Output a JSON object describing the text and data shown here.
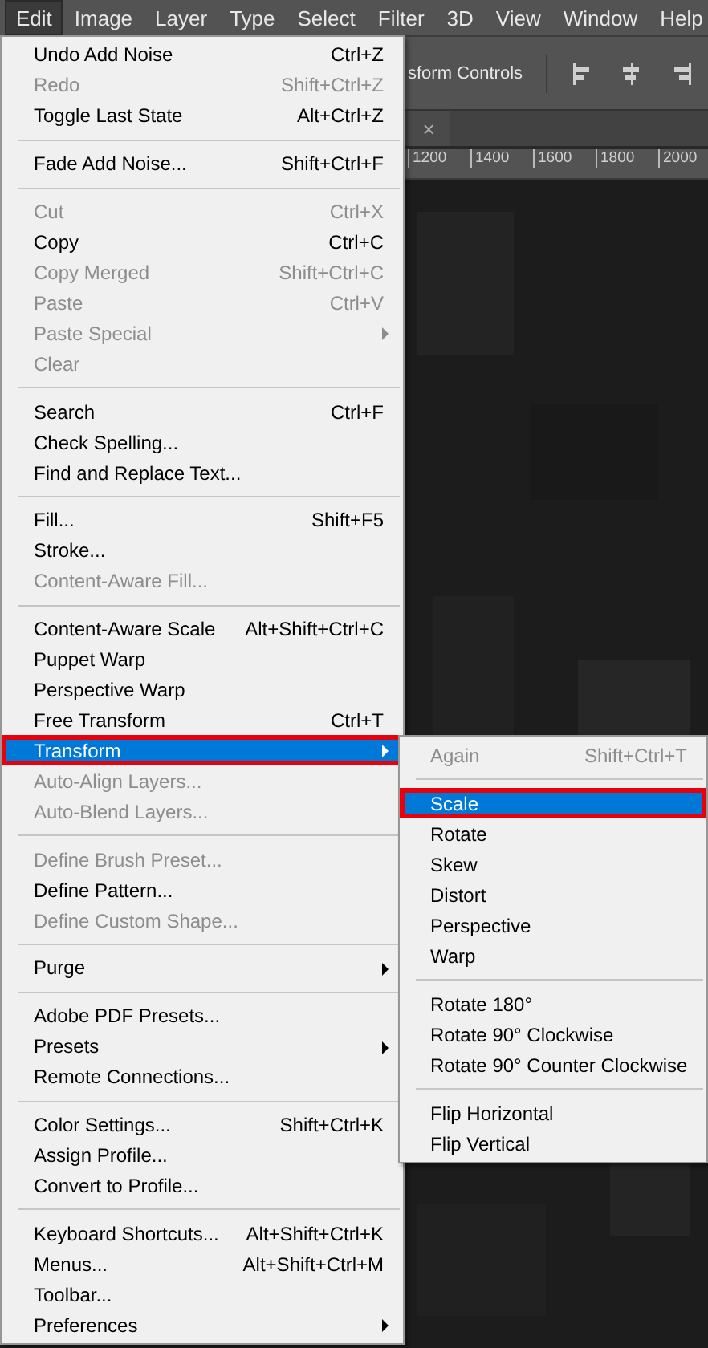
{
  "menu_bar": [
    {
      "label": "Edit",
      "selected": true
    },
    {
      "label": "Image",
      "selected": false
    },
    {
      "label": "Layer",
      "selected": false
    },
    {
      "label": "Type",
      "selected": false
    },
    {
      "label": "Select",
      "selected": false
    },
    {
      "label": "Filter",
      "selected": false
    },
    {
      "label": "3D",
      "selected": false
    },
    {
      "label": "View",
      "selected": false
    },
    {
      "label": "Window",
      "selected": false
    },
    {
      "label": "Help",
      "selected": false
    }
  ],
  "options_bar": {
    "label": "sform Controls"
  },
  "document_tab": {
    "close": "×"
  },
  "ruler": {
    "labels": [
      "1200",
      "1400",
      "1600",
      "1800",
      "2000"
    ]
  },
  "edit_menu": {
    "sections": [
      [
        {
          "label": "Undo Add Noise",
          "shortcut": "Ctrl+Z",
          "disabled": false,
          "submenu": false,
          "selected": false
        },
        {
          "label": "Redo",
          "shortcut": "Shift+Ctrl+Z",
          "disabled": true,
          "submenu": false,
          "selected": false
        },
        {
          "label": "Toggle Last State",
          "shortcut": "Alt+Ctrl+Z",
          "disabled": false,
          "submenu": false,
          "selected": false
        }
      ],
      [
        {
          "label": "Fade Add Noise...",
          "shortcut": "Shift+Ctrl+F",
          "disabled": false,
          "submenu": false,
          "selected": false
        }
      ],
      [
        {
          "label": "Cut",
          "shortcut": "Ctrl+X",
          "disabled": true,
          "submenu": false,
          "selected": false
        },
        {
          "label": "Copy",
          "shortcut": "Ctrl+C",
          "disabled": false,
          "submenu": false,
          "selected": false
        },
        {
          "label": "Copy Merged",
          "shortcut": "Shift+Ctrl+C",
          "disabled": true,
          "submenu": false,
          "selected": false
        },
        {
          "label": "Paste",
          "shortcut": "Ctrl+V",
          "disabled": true,
          "submenu": false,
          "selected": false
        },
        {
          "label": "Paste Special",
          "disabled": true,
          "submenu": true,
          "selected": false
        },
        {
          "label": "Clear",
          "disabled": true,
          "submenu": false,
          "selected": false
        }
      ],
      [
        {
          "label": "Search",
          "shortcut": "Ctrl+F",
          "disabled": false,
          "submenu": false,
          "selected": false
        },
        {
          "label": "Check Spelling...",
          "disabled": false,
          "submenu": false,
          "selected": false
        },
        {
          "label": "Find and Replace Text...",
          "disabled": false,
          "submenu": false,
          "selected": false
        }
      ],
      [
        {
          "label": "Fill...",
          "shortcut": "Shift+F5",
          "disabled": false,
          "submenu": false,
          "selected": false
        },
        {
          "label": "Stroke...",
          "disabled": false,
          "submenu": false,
          "selected": false
        },
        {
          "label": "Content-Aware Fill...",
          "disabled": true,
          "submenu": false,
          "selected": false
        }
      ],
      [
        {
          "label": "Content-Aware Scale",
          "shortcut": "Alt+Shift+Ctrl+C",
          "disabled": false,
          "submenu": false,
          "selected": false
        },
        {
          "label": "Puppet Warp",
          "disabled": false,
          "submenu": false,
          "selected": false
        },
        {
          "label": "Perspective Warp",
          "disabled": false,
          "submenu": false,
          "selected": false
        },
        {
          "label": "Free Transform",
          "shortcut": "Ctrl+T",
          "disabled": false,
          "submenu": false,
          "selected": false
        },
        {
          "label": "Transform",
          "disabled": false,
          "submenu": true,
          "selected": true
        },
        {
          "label": "Auto-Align Layers...",
          "disabled": true,
          "submenu": false,
          "selected": false
        },
        {
          "label": "Auto-Blend Layers...",
          "disabled": true,
          "submenu": false,
          "selected": false
        }
      ],
      [
        {
          "label": "Define Brush Preset...",
          "disabled": true,
          "submenu": false,
          "selected": false
        },
        {
          "label": "Define Pattern...",
          "disabled": false,
          "submenu": false,
          "selected": false
        },
        {
          "label": "Define Custom Shape...",
          "disabled": true,
          "submenu": false,
          "selected": false
        }
      ],
      [
        {
          "label": "Purge",
          "disabled": false,
          "submenu": true,
          "selected": false
        }
      ],
      [
        {
          "label": "Adobe PDF Presets...",
          "disabled": false,
          "submenu": false,
          "selected": false
        },
        {
          "label": "Presets",
          "disabled": false,
          "submenu": true,
          "selected": false
        },
        {
          "label": "Remote Connections...",
          "disabled": false,
          "submenu": false,
          "selected": false
        }
      ],
      [
        {
          "label": "Color Settings...",
          "shortcut": "Shift+Ctrl+K",
          "disabled": false,
          "submenu": false,
          "selected": false
        },
        {
          "label": "Assign Profile...",
          "disabled": false,
          "submenu": false,
          "selected": false
        },
        {
          "label": "Convert to Profile...",
          "disabled": false,
          "submenu": false,
          "selected": false
        }
      ],
      [
        {
          "label": "Keyboard Shortcuts...",
          "shortcut": "Alt+Shift+Ctrl+K",
          "disabled": false,
          "submenu": false,
          "selected": false
        },
        {
          "label": "Menus...",
          "shortcut": "Alt+Shift+Ctrl+M",
          "disabled": false,
          "submenu": false,
          "selected": false
        },
        {
          "label": "Toolbar...",
          "disabled": false,
          "submenu": false,
          "selected": false
        },
        {
          "label": "Preferences",
          "disabled": false,
          "submenu": true,
          "selected": false
        }
      ]
    ]
  },
  "transform_submenu": {
    "sections": [
      [
        {
          "label": "Again",
          "shortcut": "Shift+Ctrl+T",
          "disabled": true,
          "submenu": false,
          "selected": false
        }
      ],
      [
        {
          "label": "Scale",
          "disabled": false,
          "submenu": false,
          "selected": true
        },
        {
          "label": "Rotate",
          "disabled": false,
          "submenu": false,
          "selected": false
        },
        {
          "label": "Skew",
          "disabled": false,
          "submenu": false,
          "selected": false
        },
        {
          "label": "Distort",
          "disabled": false,
          "submenu": false,
          "selected": false
        },
        {
          "label": "Perspective",
          "disabled": false,
          "submenu": false,
          "selected": false
        },
        {
          "label": "Warp",
          "disabled": false,
          "submenu": false,
          "selected": false
        }
      ],
      [
        {
          "label": "Rotate 180°",
          "disabled": false,
          "submenu": false,
          "selected": false
        },
        {
          "label": "Rotate 90° Clockwise",
          "disabled": false,
          "submenu": false,
          "selected": false
        },
        {
          "label": "Rotate 90° Counter Clockwise",
          "disabled": false,
          "submenu": false,
          "selected": false
        }
      ],
      [
        {
          "label": "Flip Horizontal",
          "disabled": false,
          "submenu": false,
          "selected": false
        },
        {
          "label": "Flip Vertical",
          "disabled": false,
          "submenu": false,
          "selected": false
        }
      ]
    ]
  }
}
